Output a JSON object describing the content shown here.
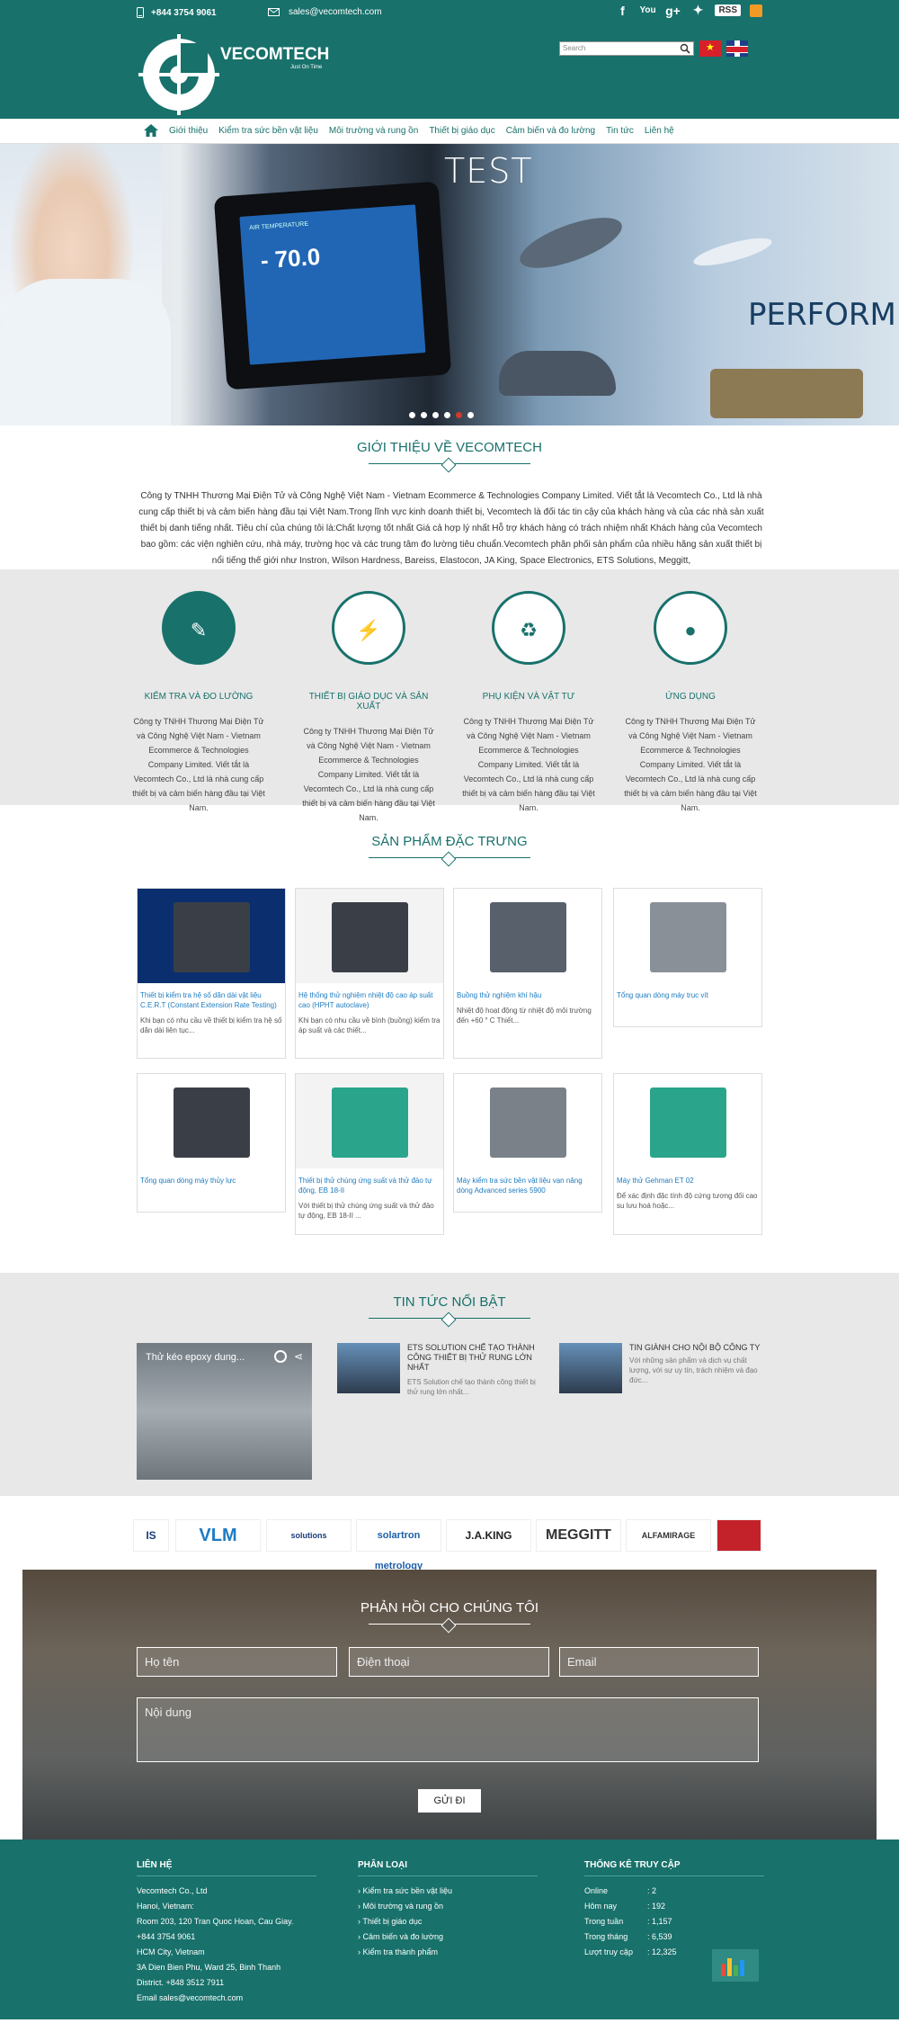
{
  "topbar": {
    "phone": "+844 3754 9061",
    "email": "sales@vecomtech.com",
    "rss": "RSS"
  },
  "brand": {
    "name": "VECOMTECH",
    "tagline": "Just On Time"
  },
  "search": {
    "placeholder": "Search"
  },
  "nav": {
    "items": [
      "Giới thiệu",
      "Kiểm tra sức bền vật liệu",
      "Môi trường và rung ồn",
      "Thiết bị giáo dục",
      "Cảm biến và đo lường",
      "Tin tức",
      "Liên hệ"
    ]
  },
  "hero": {
    "test": "TEST",
    "perform": "PERFORM",
    "screen_label": "AIR TEMPERATURE",
    "screen_value": "- 70.0",
    "slides": 6,
    "active": 5
  },
  "intro": {
    "title": "Giới thiệu về VECOMTECH",
    "text": "Công ty TNHH Thương Mại Điện Tử và Công Nghệ Việt Nam - Vietnam Ecommerce & Technologies Company Limited. Viết tắt là Vecomtech Co., Ltd là nhà cung cấp thiết bị và cảm biến hàng đầu tại Việt Nam.Trong lĩnh vực kinh doanh thiết bị, Vecomtech là đối tác tin cậy của khách hàng và của các nhà sản xuất thiết bị danh tiếng nhất. Tiêu chí của chúng tôi là:Chất lượng tốt nhất Giá cả hợp lý nhất Hỗ trợ khách hàng có trách nhiệm nhất Khách hàng của Vecomtech bao gồm: các viện nghiên cứu, nhà máy, trường học và các trung tâm đo lường tiêu chuẩn.Vecomtech phân phối sản phẩm của nhiều hãng sản xuất thiết bị nổi tiếng thế giới như Instron, Wilson Hardness, Bareiss, Elastocon, JA King, Space Electronics, ETS Solutions, Meggitt,"
  },
  "features": [
    {
      "title": "Kiểm tra và đo lường",
      "icon": "magic-wand-icon",
      "text": "Công ty TNHH Thương Mại Điện Tử và Công Nghệ Việt Nam - Vietnam Ecommerce & Technologies Company Limited. Viết tắt là Vecomtech Co., Ltd là nhà cung cấp thiết bị và cảm biến hàng đầu tại Việt Nam."
    },
    {
      "title": "Thiết bị giáo dục và sản xuất",
      "icon": "lightning-icon",
      "text": "Công ty TNHH Thương Mại Điện Tử và Công Nghệ Việt Nam - Vietnam Ecommerce & Technologies Company Limited. Viết tắt là Vecomtech Co., Ltd là nhà cung cấp thiết bị và cảm biến hàng đầu tại Việt Nam."
    },
    {
      "title": "Phụ kiện và vật tư",
      "icon": "recycle-icon",
      "text": "Công ty TNHH Thương Mại Điện Tử và Công Nghệ Việt Nam - Vietnam Ecommerce & Technologies Company Limited. Viết tắt là Vecomtech Co., Ltd là nhà cung cấp thiết bị và cảm biến hàng đầu tại Việt Nam."
    },
    {
      "title": "Ứng dụng",
      "icon": "drop-icon",
      "text": "Công ty TNHH Thương Mại Điện Tử và Công Nghệ Việt Nam - Vietnam Ecommerce & Technologies Company Limited. Viết tắt là Vecomtech Co., Ltd là nhà cung cấp thiết bị và cảm biến hàng đầu tại Việt Nam."
    }
  ],
  "products": {
    "title": "Sản phẩm đặc trưng",
    "items": [
      {
        "title": "Thiết bị kiểm tra hệ số dãn dài vật liệu C.E.R.T (Constant Extension Rate Testing)",
        "desc": "Khi bạn có nhu cầu về thiết bị kiểm tra hệ số dãn dài liên tục..."
      },
      {
        "title": "Hệ thống thử nghiệm nhiệt độ cao áp suất cao (HPHT autoclave)",
        "desc": "Khi bạn có nhu cầu về bình (buồng) kiểm tra áp suất và các thiết..."
      },
      {
        "title": "Buồng thử nghiệm khí hậu",
        "desc": "Nhiệt độ hoạt động từ nhiệt độ môi trường đến +60 ° C Thiết..."
      },
      {
        "title": "Tổng quan dòng máy trục vít",
        "desc": ""
      },
      {
        "title": "Tổng quan dòng máy thủy lực",
        "desc": ""
      },
      {
        "title": "Thiết bị thử chùng ứng suất và thử đảo tự động, EB 18-II",
        "desc": "Với thiết bị thử chùng ứng suất và thử đảo tự động, EB 18-II ..."
      },
      {
        "title": "Máy kiểm tra sức bền vật liệu vạn năng dòng Advanced series 5900",
        "desc": ""
      },
      {
        "title": "Máy thử Gehman ET 02",
        "desc": "Để xác định đặc tính độ cứng tương đối cao su lưu hoá hoặc..."
      }
    ]
  },
  "news": {
    "title": "Tin tức nổi bật",
    "video_title": "Thử kéo epoxy dung...",
    "items": [
      {
        "title": "ETS SOLUTION CHẾ TẠO THÀNH CÔNG THIẾT BỊ THỬ RUNG LỚN NHẤT",
        "desc": "ETS Solution chế tạo thành công thiết bị thử rung lớn nhất..."
      },
      {
        "title": "TIN GIÀNH CHO NỘI BỘ CÔNG TY",
        "desc": "Với những sản phẩm và dịch vụ chất lượng, với sự uy tín, trách nhiệm và đạo đức..."
      }
    ]
  },
  "partners": [
    "IS",
    "VLM",
    "solutions",
    "solartron metrology",
    "J.A.KING",
    "MEGGITT",
    "ALFAMIRAGE",
    ""
  ],
  "contact": {
    "title": "Phản hồi cho chúng tôi",
    "name": "Họ tên",
    "phone": "Điện thoại",
    "email": "Email",
    "content": "Nội dung",
    "send": "GỬI ĐI"
  },
  "footer": {
    "contact_title": "Liên hệ",
    "contact_lines": [
      "Vecomtech Co., Ltd",
      "Hanoi, Vietnam:",
      "Room 203, 120 Tran Quoc Hoan, Cau Giay.",
      "+844 3754 9061",
      "HCM City, Vietnam",
      "3A Dien Bien Phu, Ward 25, Binh Thanh",
      "District. +848 3512 7911",
      "Email sales@vecomtech.com"
    ],
    "category_title": "Phân loại",
    "categories": [
      "Kiểm tra sức bền vật liệu",
      "Môi trường và rung ồn",
      "Thiết bị giáo dục",
      "Cảm biến và đo lường",
      "Kiểm tra thành phẩm"
    ],
    "stats_title": "Thống kê truy cập",
    "stats": [
      [
        "Online",
        ": 2"
      ],
      [
        "Hôm nay",
        ": 192"
      ],
      [
        "Trong tuần",
        ": 1,157"
      ],
      [
        "Trong tháng",
        ": 6,539"
      ],
      [
        "Lượt truy cập",
        ": 12,325"
      ]
    ]
  },
  "colors": {
    "primary": "#18716b",
    "link": "#1c7bc0",
    "active_dot": "#d03a2a"
  }
}
